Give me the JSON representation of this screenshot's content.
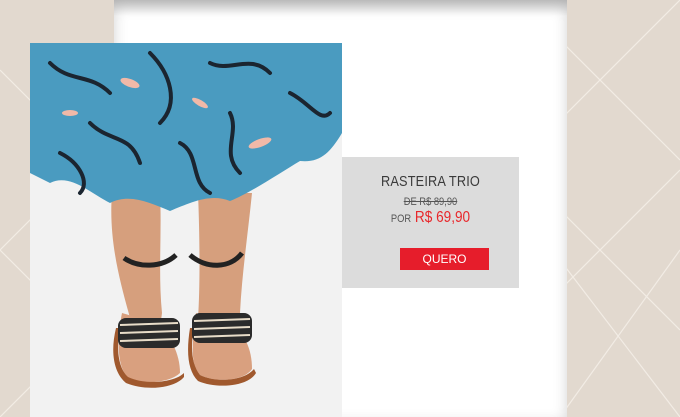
{
  "product": {
    "name": "RASTEIRA TRIO",
    "old_price": "DE R$ 89,90",
    "price_prefix": "POR",
    "price": "R$ 69,90",
    "buy_label": "QUERO"
  },
  "colors": {
    "background": "#e2d9cf",
    "card": "#dcdcdc",
    "accent": "#e61d2b",
    "skirt": "#4a9bc0"
  }
}
